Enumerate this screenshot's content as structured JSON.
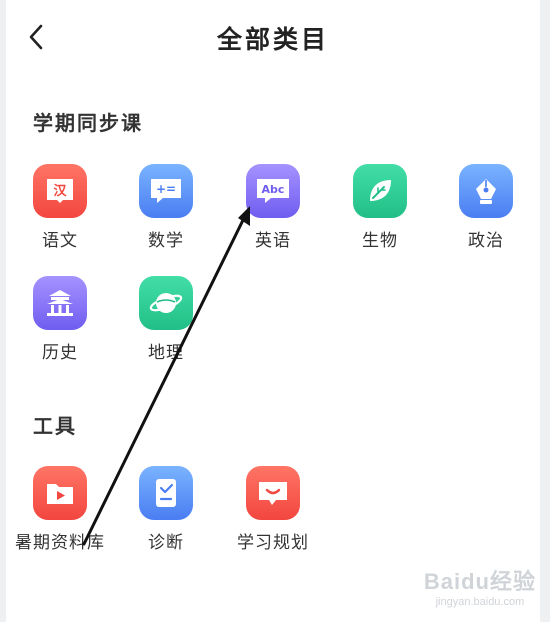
{
  "header": {
    "title": "全部类目"
  },
  "sections": [
    {
      "title": "学期同步课",
      "items": [
        {
          "label": "语文",
          "icon": "chinese-book-icon",
          "glyph": "汉",
          "color": "#f2463f"
        },
        {
          "label": "数学",
          "icon": "math-chat-icon",
          "glyph": "+=",
          "color": "#4a7ef2"
        },
        {
          "label": "英语",
          "icon": "english-chat-icon",
          "glyph": "Abc",
          "color": "#6f5df0"
        },
        {
          "label": "生物",
          "icon": "leaf-icon",
          "color": "#21bf87"
        },
        {
          "label": "政治",
          "icon": "pen-nib-icon",
          "color": "#4a7ef2"
        },
        {
          "label": "历史",
          "icon": "temple-icon",
          "color": "#6f5df0"
        },
        {
          "label": "地理",
          "icon": "planet-icon",
          "color": "#21bf87"
        }
      ]
    },
    {
      "title": "工具",
      "items": [
        {
          "label": "暑期资料库",
          "icon": "video-folder-icon",
          "color": "#f2463f"
        },
        {
          "label": "诊断",
          "icon": "checklist-icon",
          "color": "#4a7ef2"
        },
        {
          "label": "学习规划",
          "icon": "smile-chat-icon",
          "color": "#f2463f"
        }
      ]
    }
  ],
  "watermark": {
    "brand": "Baidu经验",
    "site": "jingyan.baidu.com"
  }
}
